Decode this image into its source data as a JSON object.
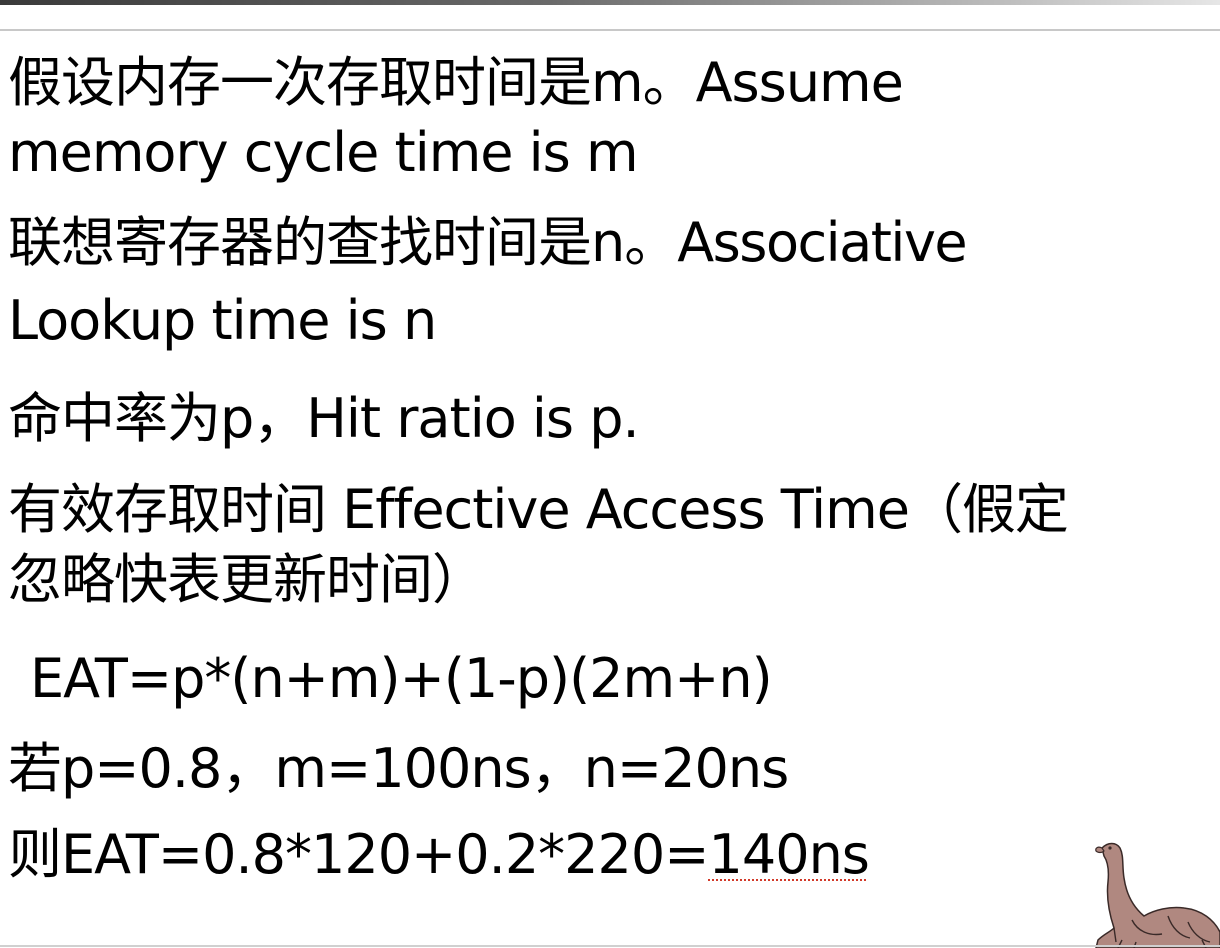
{
  "slide": {
    "lines": {
      "memory_zh": "假设内存一次存取时间是m。",
      "memory_en_1": "Assume",
      "memory_en_2": "memory cycle time is m",
      "lookup_zh": "联想寄存器的查找时间是n。",
      "lookup_en_1": "Associative",
      "lookup_en_2": "Lookup time is n",
      "hit_zh": "命中率为p，",
      "hit_en": "Hit ratio is p.",
      "eat_zh": "有效存取时间",
      "eat_en": "Effective Access Time",
      "eat_note_1": "（假定",
      "eat_note_2": "忽略快表更新时间）",
      "formula": "EAT=p*(n+m)+(1-p)(2m+n)",
      "given": "若p=0.8，m=100ns，n=20ns",
      "result_prefix": "则EAT=0.8*120+0.2*220=",
      "result_value": "140ns"
    },
    "decoration": {
      "icon": "dinosaur-icon"
    }
  },
  "colors": {
    "text": "#000000",
    "spellcheck_underline": "#d23a2a",
    "dino_body": "#b08880"
  }
}
